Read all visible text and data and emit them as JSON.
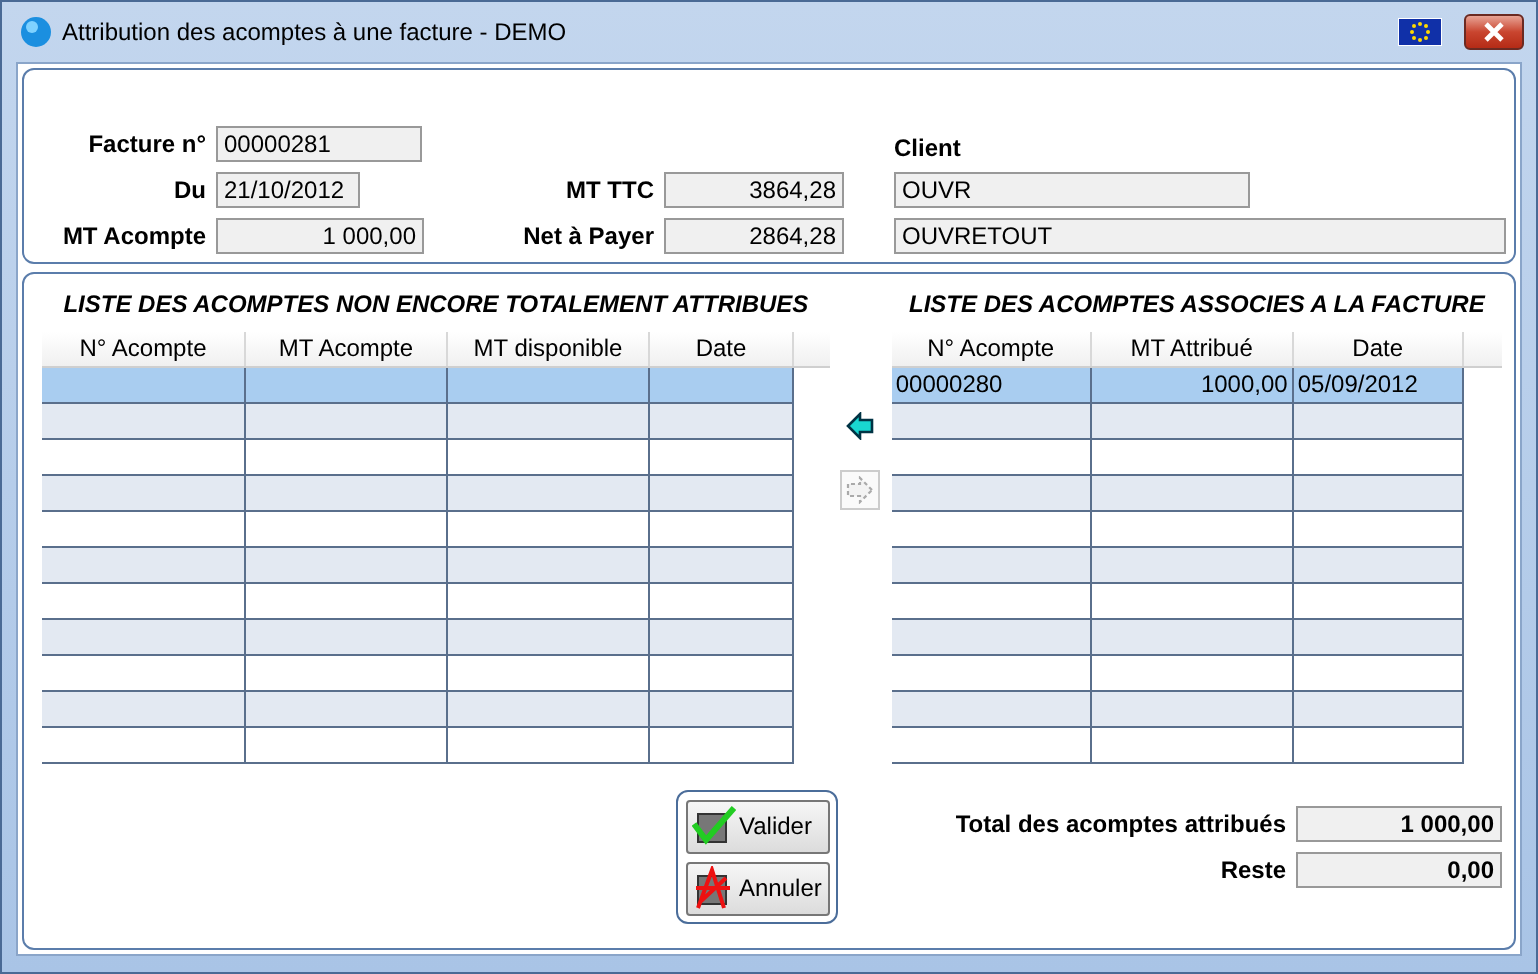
{
  "window": {
    "title": "Attribution des acomptes à une facture - DEMO"
  },
  "header": {
    "invoice_label": "Facture n°",
    "invoice": "00000281",
    "date_label": "Du",
    "date": "21/10/2012",
    "deposit_label": "MT Acompte",
    "deposit": "1 000,00",
    "ttc_label": "MT TTC",
    "ttc": "3864,28",
    "net_label": "Net à Payer",
    "net": "2864,28",
    "client_label": "Client",
    "client_code": "OUVR",
    "client_name": "OUVRETOUT"
  },
  "available_list": {
    "title": "LISTE DES ACOMPTES NON ENCORE TOTALEMENT ATTRIBUES",
    "columns": [
      "N° Acompte",
      "MT Acompte",
      "MT disponible",
      "Date"
    ],
    "cursor_on_first_row": true
  },
  "transfer_buttons": [
    {
      "kind": "left",
      "disabled": false
    },
    {
      "kind": "right",
      "disabled": true
    }
  ],
  "assigned_list": {
    "title": "LISTE DES ACOMPTES ASSOCIES A LA FACTURE",
    "columns": [
      "N° Acompte",
      "MT Attribué",
      "Date"
    ],
    "rows": [
      {
        "cells": [
          "00000280",
          "1000,00",
          "05/09/2012"
        ],
        "selected": true
      }
    ]
  },
  "buttons": [
    {
      "kind": "ok",
      "label": "Valider"
    },
    {
      "kind": "cancel",
      "label": "Annuler"
    }
  ],
  "totals": [
    {
      "label": "Total des acomptes attribués",
      "value": "1 000,00"
    },
    {
      "label": "Reste",
      "value": "0,00"
    }
  ]
}
